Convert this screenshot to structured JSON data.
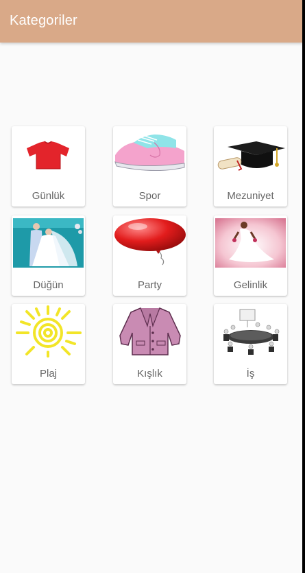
{
  "appbar": {
    "title": "Kategoriler",
    "color": "#d9a988"
  },
  "categories": [
    {
      "label": "Günlük",
      "icon": "tshirt-icon"
    },
    {
      "label": "Spor",
      "icon": "sneaker-icon"
    },
    {
      "label": "Mezuniyet",
      "icon": "graduation-cap-icon"
    },
    {
      "label": "Düğün",
      "icon": "wedding-couple-icon"
    },
    {
      "label": "Party",
      "icon": "balloon-icon"
    },
    {
      "label": "Gelinlik",
      "icon": "bride-icon"
    },
    {
      "label": "Plaj",
      "icon": "sun-icon"
    },
    {
      "label": "Kışlık",
      "icon": "coat-icon"
    },
    {
      "label": "İş",
      "icon": "meeting-icon"
    }
  ]
}
